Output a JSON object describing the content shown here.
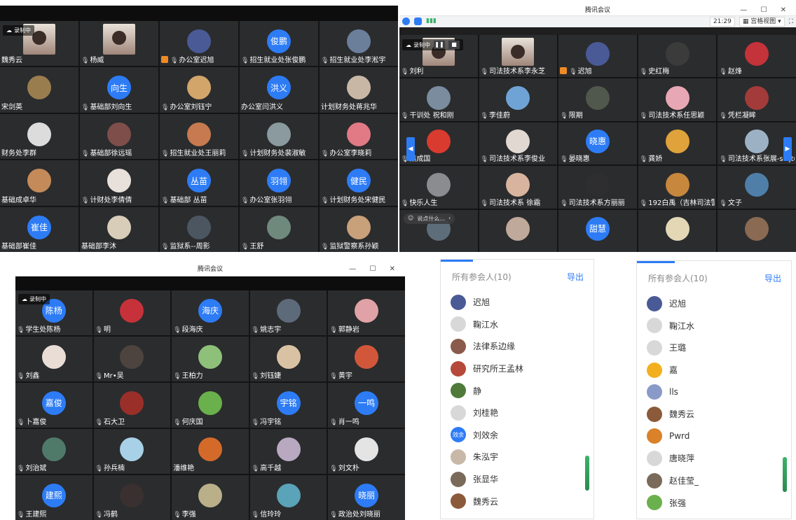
{
  "colors": {
    "accent": "#2d7cf6",
    "tile": "#2b2c2e",
    "gap": "#141414",
    "mute": "#cfcfcf",
    "scroll": "#3bb26a"
  },
  "icons": {
    "mic": "mic-icon",
    "record": "cloud-record-icon",
    "host": "host-badge-icon"
  },
  "panel_a": {
    "record_label": "录制中",
    "tiles": [
      {
        "name": "魏秀云",
        "mic": false,
        "avatar_text": "",
        "color": "#c6b8a8",
        "video": true
      },
      {
        "name": "杨威",
        "mic": true,
        "avatar_text": "",
        "color": "#b99a8e",
        "video": true
      },
      {
        "name": "办公室迟旭",
        "mic": true,
        "host": true,
        "avatar_text": "",
        "color": "#4a5a96"
      },
      {
        "name": "招生就业处张俊鹏",
        "mic": true,
        "avatar_text": "俊鹏",
        "color": "#2d7cf6"
      },
      {
        "name": "招生就业处李淞宇",
        "mic": true,
        "avatar_text": "",
        "color": "#6b7f9b"
      },
      {
        "name": "宋剑英",
        "mic": false,
        "avatar_text": "",
        "color": "#9a7d4f"
      },
      {
        "name": "基础部刘向生",
        "mic": true,
        "avatar_text": "向生",
        "color": "#2d7cf6"
      },
      {
        "name": "办公室刘钰宁",
        "mic": true,
        "avatar_text": "",
        "color": "#d2a56a"
      },
      {
        "name": "办公室闫洪义",
        "mic": false,
        "avatar_text": "洪义",
        "color": "#2d7cf6"
      },
      {
        "name": "计划财务处蒋兆华",
        "mic": false,
        "avatar_text": "",
        "color": "#c9b7a6"
      },
      {
        "name": "财务处李群",
        "mic": false,
        "avatar_text": "",
        "color": "#dcdcdc"
      },
      {
        "name": "基础部徐远瑶",
        "mic": true,
        "avatar_text": "",
        "color": "#7d4e4a"
      },
      {
        "name": "招生就业处王丽莉",
        "mic": true,
        "avatar_text": "",
        "color": "#c77a4f"
      },
      {
        "name": "计划财务处裴淑敏",
        "mic": true,
        "avatar_text": "",
        "color": "#8a9a9e"
      },
      {
        "name": "办公室李晓莉",
        "mic": true,
        "avatar_text": "",
        "color": "#e27a86"
      },
      {
        "name": "基础成卓华",
        "mic": false,
        "avatar_text": "",
        "color": "#c48a5a"
      },
      {
        "name": "计财处李倩倩",
        "mic": true,
        "avatar_text": "",
        "color": "#e8e0da"
      },
      {
        "name": "基础部 丛苗",
        "mic": true,
        "avatar_text": "丛苗",
        "color": "#2d7cf6"
      },
      {
        "name": "办公室张羽翎",
        "mic": true,
        "avatar_text": "羽翎",
        "color": "#2d7cf6"
      },
      {
        "name": "计划财务处宋健民",
        "mic": true,
        "avatar_text": "健民",
        "color": "#2d7cf6"
      },
      {
        "name": "基础部崔佳",
        "mic": false,
        "avatar_text": "崔佳",
        "color": "#2d7cf6"
      },
      {
        "name": "基础部李沐",
        "mic": false,
        "avatar_text": "",
        "color": "#d8cdb8"
      },
      {
        "name": "监狱系--周影",
        "mic": true,
        "avatar_text": "",
        "color": "#4b5660"
      },
      {
        "name": "王舒",
        "mic": true,
        "avatar_text": "",
        "color": "#6f8a7c"
      },
      {
        "name": "监狱警察系孙颖",
        "mic": true,
        "avatar_text": "",
        "color": "#c8a07a"
      }
    ]
  },
  "panel_b": {
    "window_title": "腾讯会议",
    "time": "21:29",
    "view_label": "宫格视图",
    "record_label": "录制中",
    "chat_placeholder": "说点什么...",
    "tiles": [
      {
        "name": "刘利",
        "mic": true,
        "avatar_text": "",
        "color": "#b7a79a",
        "video": true
      },
      {
        "name": "司法技术系李永芝",
        "mic": true,
        "avatar_text": "",
        "color": "#d9b8a6",
        "video": true
      },
      {
        "name": "迟旭",
        "mic": true,
        "host": true,
        "avatar_text": "",
        "color": "#4a5a96"
      },
      {
        "name": "史红梅",
        "mic": true,
        "avatar_text": "",
        "color": "#3b3b3b"
      },
      {
        "name": "赵烽",
        "mic": true,
        "avatar_text": "",
        "color": "#c4323a"
      },
      {
        "name": "干训处 祝和刚",
        "mic": true,
        "avatar_text": "",
        "color": "#7a8c9e"
      },
      {
        "name": "李佳蔚",
        "mic": true,
        "avatar_text": "",
        "color": "#6fa3d6"
      },
      {
        "name": "限期",
        "mic": true,
        "avatar_text": "",
        "color": "#50574d"
      },
      {
        "name": "司法技术系任思颖",
        "mic": true,
        "avatar_text": "",
        "color": "#e8a7b4"
      },
      {
        "name": "凭栏凝眸",
        "mic": true,
        "avatar_text": "",
        "color": "#a33b3b"
      },
      {
        "name": "焦成国",
        "mic": true,
        "avatar_text": "",
        "color": "#d93b2f"
      },
      {
        "name": "司法技术系李俊业",
        "mic": true,
        "avatar_text": "",
        "color": "#e2d8d2"
      },
      {
        "name": "晏晓惠",
        "mic": true,
        "avatar_text": "晓惠",
        "color": "#2d7cf6"
      },
      {
        "name": "龚娇",
        "mic": true,
        "avatar_text": "",
        "color": "#e0a23a"
      },
      {
        "name": "司法技术系张展-swjtu",
        "mic": true,
        "avatar_text": "",
        "color": "#9cb2c4"
      },
      {
        "name": "快乐人生",
        "mic": true,
        "avatar_text": "",
        "color": "#8a8c90"
      },
      {
        "name": "司法技术系 徐霜",
        "mic": true,
        "avatar_text": "",
        "color": "#d8b49e"
      },
      {
        "name": "司法技术系方丽丽",
        "mic": true,
        "avatar_text": "",
        "color": "#2e2e30"
      },
      {
        "name": "192白禹（吉林司法警...",
        "mic": true,
        "avatar_text": "",
        "color": "#c7873d"
      },
      {
        "name": "文子",
        "mic": true,
        "avatar_text": "",
        "color": "#4f7fa8"
      },
      {
        "name": "",
        "mic": false,
        "avatar_text": "",
        "color": "#5e6d7a"
      },
      {
        "name": "",
        "mic": false,
        "avatar_text": "",
        "color": "#bfa99a"
      },
      {
        "name": "",
        "mic": false,
        "avatar_text": "甜慧",
        "color": "#2d7cf6"
      },
      {
        "name": "",
        "mic": false,
        "avatar_text": "",
        "color": "#e3d7b6"
      },
      {
        "name": "",
        "mic": false,
        "avatar_text": "",
        "color": "#8a6a52"
      }
    ]
  },
  "panel_c": {
    "window_title": "腾讯会议",
    "record_label": "录制中",
    "tiles": [
      {
        "name": "学生处陈杨",
        "mic": true,
        "avatar_text": "陈杨",
        "color": "#2d7cf6"
      },
      {
        "name": "明",
        "mic": true,
        "avatar_text": "",
        "color": "#c7323a"
      },
      {
        "name": "段海庆",
        "mic": true,
        "avatar_text": "海庆",
        "color": "#2d7cf6"
      },
      {
        "name": "姚志宇",
        "mic": true,
        "avatar_text": "",
        "color": "#5d6a7a"
      },
      {
        "name": "郭静岩",
        "mic": true,
        "avatar_text": "",
        "color": "#e0a2a6"
      },
      {
        "name": "刘鑫",
        "mic": true,
        "avatar_text": "",
        "color": "#e9ddd6"
      },
      {
        "name": "Mr•吴",
        "mic": true,
        "avatar_text": "",
        "color": "#4d4440"
      },
      {
        "name": "王柏力",
        "mic": true,
        "avatar_text": "",
        "color": "#8ec07a"
      },
      {
        "name": "刘钰婕",
        "mic": true,
        "avatar_text": "",
        "color": "#d9c2a4"
      },
      {
        "name": "黄宇",
        "mic": true,
        "avatar_text": "",
        "color": "#d2573a"
      },
      {
        "name": "卜嘉俊",
        "mic": true,
        "avatar_text": "嘉俊",
        "color": "#2d7cf6"
      },
      {
        "name": "石大卫",
        "mic": true,
        "avatar_text": "",
        "color": "#9a2f2a"
      },
      {
        "name": "何庆国",
        "mic": true,
        "avatar_text": "",
        "color": "#6ab04c"
      },
      {
        "name": "冯宇铭",
        "mic": true,
        "avatar_text": "宇铭",
        "color": "#2d7cf6"
      },
      {
        "name": "肖一鸣",
        "mic": true,
        "avatar_text": "一鸣",
        "color": "#2d7cf6"
      },
      {
        "name": "刘治斌",
        "mic": true,
        "avatar_text": "",
        "color": "#4f7a6a"
      },
      {
        "name": "孙兵楠",
        "mic": true,
        "avatar_text": "",
        "color": "#a8d0e6"
      },
      {
        "name": "潘维艳",
        "mic": false,
        "avatar_text": "",
        "color": "#d46a2a"
      },
      {
        "name": "高千越",
        "mic": true,
        "avatar_text": "",
        "color": "#b8a8c0"
      },
      {
        "name": "刘文朴",
        "mic": true,
        "avatar_text": "",
        "color": "#e4e4e4"
      },
      {
        "name": "王建熙",
        "mic": true,
        "avatar_text": "建熙",
        "color": "#2d7cf6"
      },
      {
        "name": "冯鹤",
        "mic": true,
        "avatar_text": "",
        "color": "#3a3030"
      },
      {
        "name": "李强",
        "mic": true,
        "avatar_text": "",
        "color": "#b9b08a"
      },
      {
        "name": "信玲玲",
        "mic": true,
        "avatar_text": "",
        "color": "#5aa3b8"
      },
      {
        "name": "政治处刘晓丽",
        "mic": true,
        "avatar_text": "晓丽",
        "color": "#2d7cf6"
      }
    ]
  },
  "panel_d": {
    "title": "所有参会人(10)",
    "export_label": "导出",
    "items": [
      {
        "name": "迟旭",
        "color": "#4a5a96",
        "avatar_text": ""
      },
      {
        "name": "鞠江水",
        "color": "#d8d8d8",
        "avatar_text": ""
      },
      {
        "name": "法律系边缘",
        "color": "#8a5a4a",
        "avatar_text": ""
      },
      {
        "name": "研究所王孟林",
        "color": "#b54a3a",
        "avatar_text": ""
      },
      {
        "name": "静",
        "color": "#4f7a3a",
        "avatar_text": ""
      },
      {
        "name": "刘桂艳",
        "color": "#d8d8d8",
        "avatar_text": ""
      },
      {
        "name": "刘效余",
        "color": "#2d7cf6",
        "avatar_text": "效余"
      },
      {
        "name": "朱泓宇",
        "color": "#c8b8a8",
        "avatar_text": ""
      },
      {
        "name": "张显华",
        "color": "#7a6a5a",
        "avatar_text": ""
      },
      {
        "name": "魏秀云",
        "color": "#8a5a3a",
        "avatar_text": ""
      }
    ]
  },
  "panel_e": {
    "title": "所有参会人(10)",
    "export_label": "导出",
    "items": [
      {
        "name": "迟旭",
        "color": "#4a5a96",
        "avatar_text": ""
      },
      {
        "name": "鞠江水",
        "color": "#d8d8d8",
        "avatar_text": ""
      },
      {
        "name": "王璐",
        "color": "#d8d8d8",
        "avatar_text": ""
      },
      {
        "name": "嘉",
        "color": "#f2b01e",
        "avatar_text": ""
      },
      {
        "name": "lls",
        "color": "#8a9ac8",
        "avatar_text": ""
      },
      {
        "name": "魏秀云",
        "color": "#8a5a3a",
        "avatar_text": ""
      },
      {
        "name": "Pwrd",
        "color": "#d9822a",
        "avatar_text": ""
      },
      {
        "name": "唐晓萍",
        "color": "#d8d8d8",
        "avatar_text": ""
      },
      {
        "name": "赵佳莹_",
        "color": "#7a6a5a",
        "avatar_text": ""
      },
      {
        "name": "张强",
        "color": "#6ab04c",
        "avatar_text": ""
      }
    ]
  }
}
